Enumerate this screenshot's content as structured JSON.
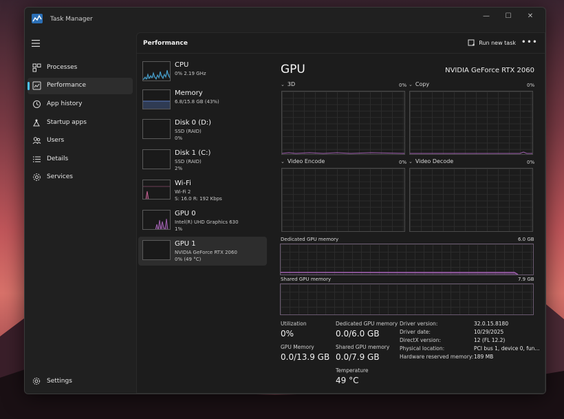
{
  "window": {
    "title": "Task Manager",
    "controls": [
      "—",
      "☐",
      "✕"
    ]
  },
  "nav": {
    "items": [
      {
        "label": "Processes",
        "icon": "processes-icon"
      },
      {
        "label": "Performance",
        "icon": "performance-icon",
        "active": true
      },
      {
        "label": "App history",
        "icon": "history-icon"
      },
      {
        "label": "Startup apps",
        "icon": "startup-icon"
      },
      {
        "label": "Users",
        "icon": "users-icon"
      },
      {
        "label": "Details",
        "icon": "details-icon"
      },
      {
        "label": "Services",
        "icon": "services-icon"
      }
    ],
    "settings": "Settings"
  },
  "header": {
    "title": "Performance",
    "run_new_task": "Run new task",
    "more": "•••"
  },
  "devices": [
    {
      "name": "CPU",
      "line1": "0% 2.19 GHz",
      "line2": "",
      "color": "#4aa8d8"
    },
    {
      "name": "Memory",
      "line1": "6.8/15.8 GB (43%)",
      "line2": "",
      "color": "#5a7ac0"
    },
    {
      "name": "Disk 0 (D:)",
      "line1": "SSD (RAID)",
      "line2": "0%",
      "color": "#6ab04c"
    },
    {
      "name": "Disk 1 (C:)",
      "line1": "SSD (RAID)",
      "line2": "2%",
      "color": "#6ab04c"
    },
    {
      "name": "Wi-Fi",
      "line1": "Wi-Fi 2",
      "line2": "S: 16.0  R: 192 Kbps",
      "color": "#c06090"
    },
    {
      "name": "GPU 0",
      "line1": "Intel(R) UHD Graphics 630",
      "line2": "1%",
      "color": "#a060b0"
    },
    {
      "name": "GPU 1",
      "line1": "NVIDIA GeForce RTX 2060",
      "line2": "0% (49 °C)",
      "color": "#a060b0",
      "active": true
    }
  ],
  "detail": {
    "title": "GPU",
    "device_name": "NVIDIA GeForce RTX 2060",
    "engines": [
      {
        "label": "3D",
        "percent": "0%"
      },
      {
        "label": "Copy",
        "percent": "0%"
      },
      {
        "label": "Video Encode",
        "percent": "0%"
      },
      {
        "label": "Video Decode",
        "percent": "0%"
      }
    ],
    "dedicated_memory": {
      "label": "Dedicated GPU memory",
      "max": "6.0 GB"
    },
    "shared_memory": {
      "label": "Shared GPU memory",
      "max": "7.9 GB"
    },
    "stats": {
      "utilization_label": "Utilization",
      "utilization_value": "0%",
      "gpu_memory_label": "GPU Memory",
      "gpu_memory_value": "0.0/13.9 GB",
      "dedicated_label": "Dedicated GPU memory",
      "dedicated_value": "0.0/6.0 GB",
      "shared_label": "Shared GPU memory",
      "shared_value": "0.0/7.9 GB",
      "temperature_label": "Temperature",
      "temperature_value": "49 °C"
    },
    "info": [
      {
        "key": "Driver version:",
        "value": "32.0.15.8180"
      },
      {
        "key": "Driver date:",
        "value": "10/29/2025"
      },
      {
        "key": "DirectX version:",
        "value": "12 (FL 12.2)"
      },
      {
        "key": "Physical location:",
        "value": "PCI bus 1, device 0, fun..."
      },
      {
        "key": "Hardware reserved memory:",
        "value": "189 MB"
      }
    ]
  },
  "colors": {
    "accent": "#4cc2ff",
    "gpu_line": "#a060b0"
  }
}
